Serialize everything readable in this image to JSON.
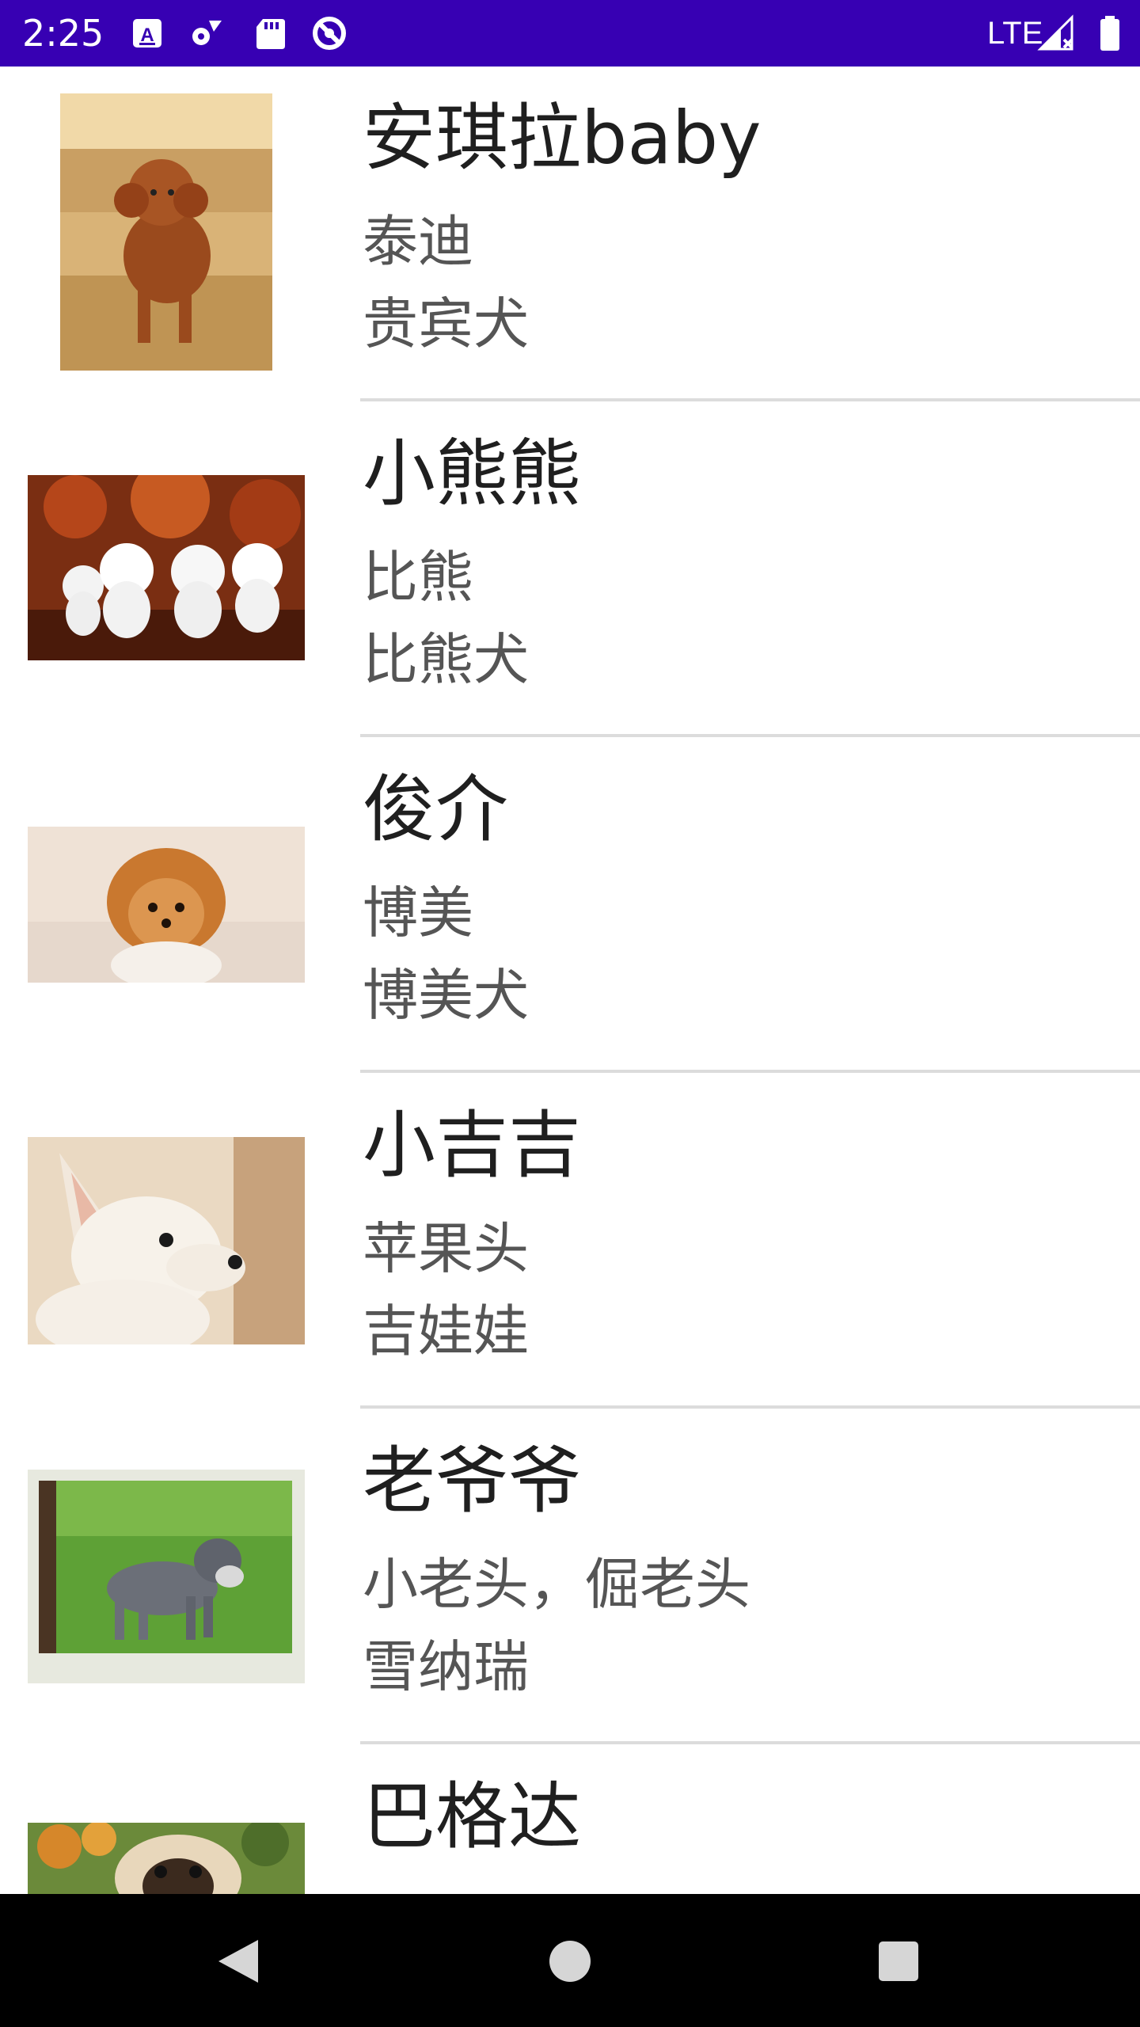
{
  "status_bar": {
    "time": "2:25",
    "network": "LTE",
    "background_color": "#3700b3",
    "icons": [
      "a-icon",
      "settings-icon",
      "sd-card-icon",
      "sync-icon",
      "signal-icon",
      "battery-icon"
    ]
  },
  "dogs": [
    {
      "title": "安琪拉baby",
      "line1": "泰迪",
      "line2": "贵宾犬",
      "photo": "poodle-photo"
    },
    {
      "title": "小熊熊",
      "line1": "比熊",
      "line2": "比熊犬",
      "photo": "bichon-photo"
    },
    {
      "title": "俊介",
      "line1": "博美",
      "line2": "博美犬",
      "photo": "pomeranian-photo"
    },
    {
      "title": "小吉吉",
      "line1": "苹果头",
      "line2": "吉娃娃",
      "photo": "chihuahua-photo"
    },
    {
      "title": "老爷爷",
      "line1": "小老头，倔老头",
      "line2": "雪纳瑞",
      "photo": "schnauzer-photo"
    },
    {
      "title": "巴格达",
      "photo": "pug-photo"
    }
  ],
  "nav_bar": {
    "buttons": [
      "back-icon",
      "home-icon",
      "recents-icon"
    ]
  }
}
